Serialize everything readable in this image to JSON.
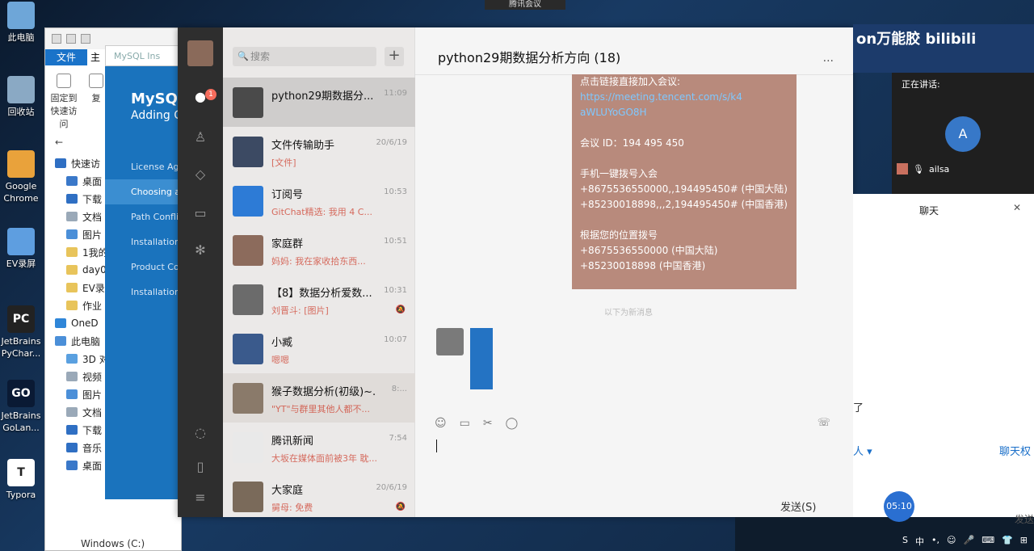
{
  "top_tray": "腾讯会议",
  "desktop_icons": [
    {
      "label": "此电脑",
      "color": "#6ea6d8",
      "glyph": ""
    },
    {
      "label": "回收站",
      "color": "#8aa9c4",
      "glyph": ""
    },
    {
      "label": "Google Chrome",
      "color": "#e9a23b",
      "glyph": ""
    },
    {
      "label": "EV录屏",
      "color": "#5e9ee0",
      "glyph": ""
    },
    {
      "label": "JetBrains PyChar...",
      "color": "#222222",
      "glyph": "PC"
    },
    {
      "label": "JetBrains GoLan...",
      "color": "#0a1a34",
      "glyph": "GO"
    },
    {
      "label": "Typora",
      "color": "#ffffff",
      "glyph": "T"
    }
  ],
  "explorer": {
    "tab_file": "文件",
    "tab_2": "主",
    "ribbon": [
      "固定到快速访问",
      "复"
    ],
    "nav_back": "←",
    "tree": [
      {
        "label": "快速访",
        "level": 1,
        "color": "#2f6fc3"
      },
      {
        "label": "桌面",
        "level": 2,
        "color": "#3a78c9"
      },
      {
        "label": "下载",
        "level": 2,
        "color": "#2f6fc3"
      },
      {
        "label": "文档",
        "level": 2,
        "color": "#9aa9b8"
      },
      {
        "label": "图片",
        "level": 2,
        "color": "#4b8fd8"
      },
      {
        "label": "1我的",
        "level": 2,
        "color": "#e8c45b"
      },
      {
        "label": "day0",
        "level": 2,
        "color": "#e8c45b"
      },
      {
        "label": "EV录",
        "level": 2,
        "color": "#e8c45b"
      },
      {
        "label": "作业",
        "level": 2,
        "color": "#e8c45b"
      },
      {
        "label": "OneD",
        "level": 1,
        "color": "#2f86d8"
      },
      {
        "label": "此电脑",
        "level": 1,
        "color": "#4b8fd8"
      },
      {
        "label": "3D 对",
        "level": 2,
        "color": "#5aa0e0"
      },
      {
        "label": "视频",
        "level": 2,
        "color": "#9aa9b8"
      },
      {
        "label": "图片",
        "level": 2,
        "color": "#4b8fd8"
      },
      {
        "label": "文档",
        "level": 2,
        "color": "#9aa9b8"
      },
      {
        "label": "下载",
        "level": 2,
        "color": "#2f6fc3"
      },
      {
        "label": "音乐",
        "level": 2,
        "color": "#2f6fc3"
      },
      {
        "label": "桌面",
        "level": 2,
        "color": "#3a78c9"
      }
    ],
    "drive": "Windows (C:)"
  },
  "mysql": {
    "window_title": "MySQL Ins",
    "brand": "MySQL",
    "subtitle": "Adding C",
    "steps": [
      "License Agr",
      "Choosing a",
      "Path Confli",
      "Installation",
      "Product Co",
      "Installation"
    ],
    "active_step": 1
  },
  "wechat": {
    "unread_badge": "1",
    "search_placeholder": "搜索",
    "add_button": "+",
    "chats": [
      {
        "name": "python29期数据分...",
        "preview": "",
        "time": "11:09",
        "avatar_color": "#4a4a4a",
        "selected": true,
        "mute": ""
      },
      {
        "name": "文件传输助手",
        "preview": "[文件]",
        "time": "20/6/19",
        "avatar_color": "#3c4a63",
        "selected": false,
        "mute": ""
      },
      {
        "name": "订阅号",
        "preview": "GitChat精选: 我用 4 C...",
        "time": "10:53",
        "avatar_color": "#2d7bd6",
        "selected": false,
        "mute": ""
      },
      {
        "name": "家庭群",
        "preview": "妈妈: 我在家收拾东西...",
        "time": "10:51",
        "avatar_color": "#8c6b5c",
        "selected": false,
        "mute": ""
      },
      {
        "name": "【8】数据分析爱数...",
        "preview": "刘晋斗: [图片]",
        "time": "10:31",
        "avatar_color": "#6b6b6b",
        "selected": false,
        "mute": "🔕"
      },
      {
        "name": "小臧",
        "preview": "嗯嗯",
        "time": "10:07",
        "avatar_color": "#3a5a8c",
        "selected": false,
        "mute": ""
      },
      {
        "name": "猴子数据分析(初级)~...",
        "preview": "\"YT\"与群里其他人都不...",
        "time": "8:...",
        "avatar_color": "#8a7a6a",
        "selected": false,
        "mute": "",
        "hl": true
      },
      {
        "name": "腾讯新闻",
        "preview": "大坂在媒体面前被3年 耽...",
        "time": "7:54",
        "avatar_color": "#e9e9e9",
        "selected": false,
        "mute": ""
      },
      {
        "name": "大家庭",
        "preview": "舅母: 免费",
        "time": "20/6/19",
        "avatar_color": "#7a6a5a",
        "selected": false,
        "mute": "🔕"
      }
    ],
    "chat_title": "python29期数据分析方向 (18)",
    "more": "...",
    "card_lines": [
      {
        "text": "点击链接直接加入会议:",
        "link": false
      },
      {
        "text": "https://meeting.tencent.com/s/k4",
        "link": true
      },
      {
        "text": "aWLUYoGO8H",
        "link": true
      },
      {
        "text": "",
        "link": false
      },
      {
        "text": "会议 ID：194 495 450",
        "link": false
      },
      {
        "text": "",
        "link": false
      },
      {
        "text": "手机一键拨号入会",
        "link": false
      },
      {
        "text": "+8675536550000,,194495450# (中国大陆)",
        "link": false
      },
      {
        "text": "+85230018898,,,2,194495450# (中国香港)",
        "link": false
      },
      {
        "text": "",
        "link": false
      },
      {
        "text": "根据您的位置拨号",
        "link": false
      },
      {
        "text": "+8675536550000 (中国大陆)",
        "link": false
      },
      {
        "text": "+85230018898 (中国香港)",
        "link": false
      }
    ],
    "system_text": "以下为新消息"
  },
  "meeting": {
    "banner": "on万能胶 bilibili",
    "speaking": "正在讲话:",
    "avatar_letter": "A",
    "user": "ailsa",
    "chat_title": "聊天",
    "close": "✕",
    "frag1": "了",
    "frag2": "人 ▾",
    "perm": "聊天权",
    "send": "发送(S)",
    "send2": "发送",
    "timer": "05:10"
  },
  "taskbar": [
    "S",
    "中",
    "•,",
    "☺",
    "🎤",
    "⌨",
    "👕",
    "⊞"
  ],
  "colors": {
    "accent": "#1a73bd",
    "wechat_side": "#2e2e2e",
    "card": "#b88a7c"
  }
}
